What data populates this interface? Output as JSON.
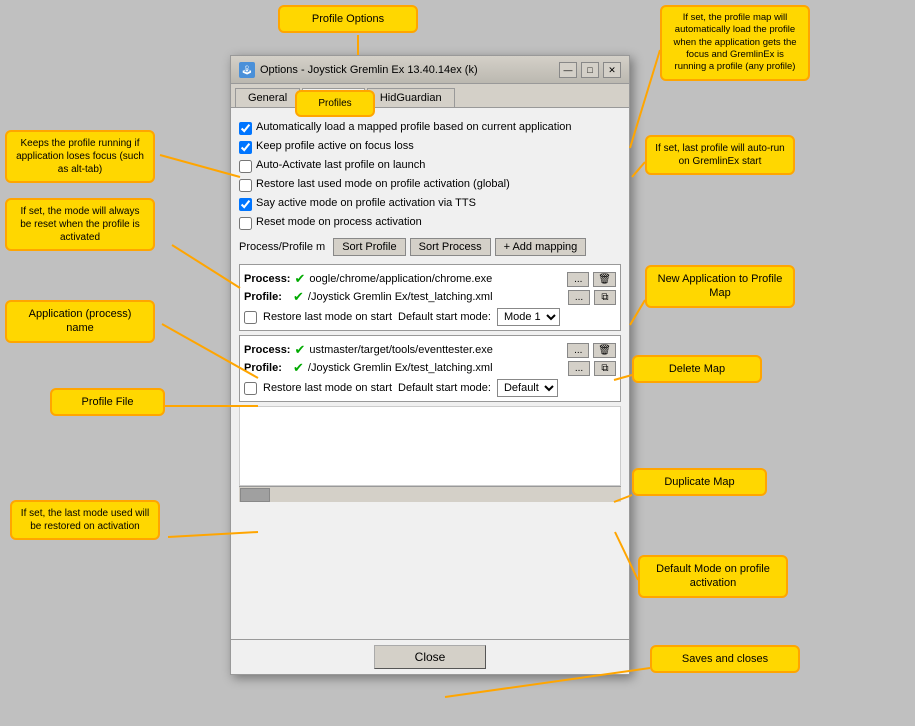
{
  "title": "Profile Options",
  "dialog": {
    "titlebar": "Options - Joystick Gremlin Ex 13.40.14ex (k)",
    "titlebar_icon": "🎮",
    "tabs": [
      {
        "label": "General",
        "active": false
      },
      {
        "label": "Profiles",
        "active": true
      },
      {
        "label": "HidGuardian",
        "active": false
      }
    ],
    "options": [
      {
        "id": "auto-load",
        "checked": true,
        "label": "Automatically load a mapped profile based on current application"
      },
      {
        "id": "keep-active",
        "checked": true,
        "label": "Keep profile active on focus loss"
      },
      {
        "id": "auto-activate",
        "checked": false,
        "label": "Auto-Activate last profile on launch"
      },
      {
        "id": "restore-mode",
        "checked": false,
        "label": "Restore last used mode on profile activation (global)"
      },
      {
        "id": "say-active",
        "checked": true,
        "label": "Say active mode on profile activation via TTS"
      },
      {
        "id": "reset-mode",
        "checked": false,
        "label": "Reset mode on process activation"
      }
    ],
    "toolbar": {
      "column_label": "Process/Profile m",
      "sort_profile_btn": "Sort Profile",
      "sort_process_btn": "Sort Process",
      "add_mapping_btn": "+ Add mapping"
    },
    "mappings": [
      {
        "process_value": "oogle/chrome/application/chrome.exe",
        "profile_value": "/Joystick Gremlin Ex/test_latching.xml",
        "restore_checked": false,
        "restore_label": "Restore last mode on start",
        "default_mode_label": "Default start mode:",
        "mode_value": "Mode 1"
      },
      {
        "process_value": "ustmaster/target/tools/eventtester.exe",
        "profile_value": "/Joystick Gremlin Ex/test_latching.xml",
        "restore_checked": false,
        "restore_label": "Restore last mode on start",
        "default_mode_label": "Default start mode:",
        "mode_value": "Default"
      }
    ],
    "close_btn": "Close"
  },
  "annotations": {
    "title": "Profile Options",
    "profiles_tab": "Profiles",
    "auto_load": "If set, the profile map will automatically load the profile when the application gets the focus and GremlinEx is running a profile (any profile)",
    "last_profile": "If set, last profile will auto-run on GremlinEx start",
    "keep_running": "Keeps the profile running if application loses focus (such as alt-tab)",
    "mode_reset": "If set, the mode will always be reset when the profile is activated",
    "process_name": "Application (process) name",
    "profile_file": "Profile File",
    "new_app_map": "New Application to Profile Map",
    "delete_map": "Delete Map",
    "duplicate_map": "Duplicate Map",
    "default_mode": "Default Mode on profile activation",
    "last_mode": "If set, the last mode used will be restored on activation",
    "saves": "Saves and closes"
  },
  "icons": {
    "minimize": "—",
    "maximize": "□",
    "close": "✕",
    "check": "✔",
    "ellipsis": "...",
    "copy": "⧉",
    "delete": "🗑",
    "plus": "+"
  }
}
